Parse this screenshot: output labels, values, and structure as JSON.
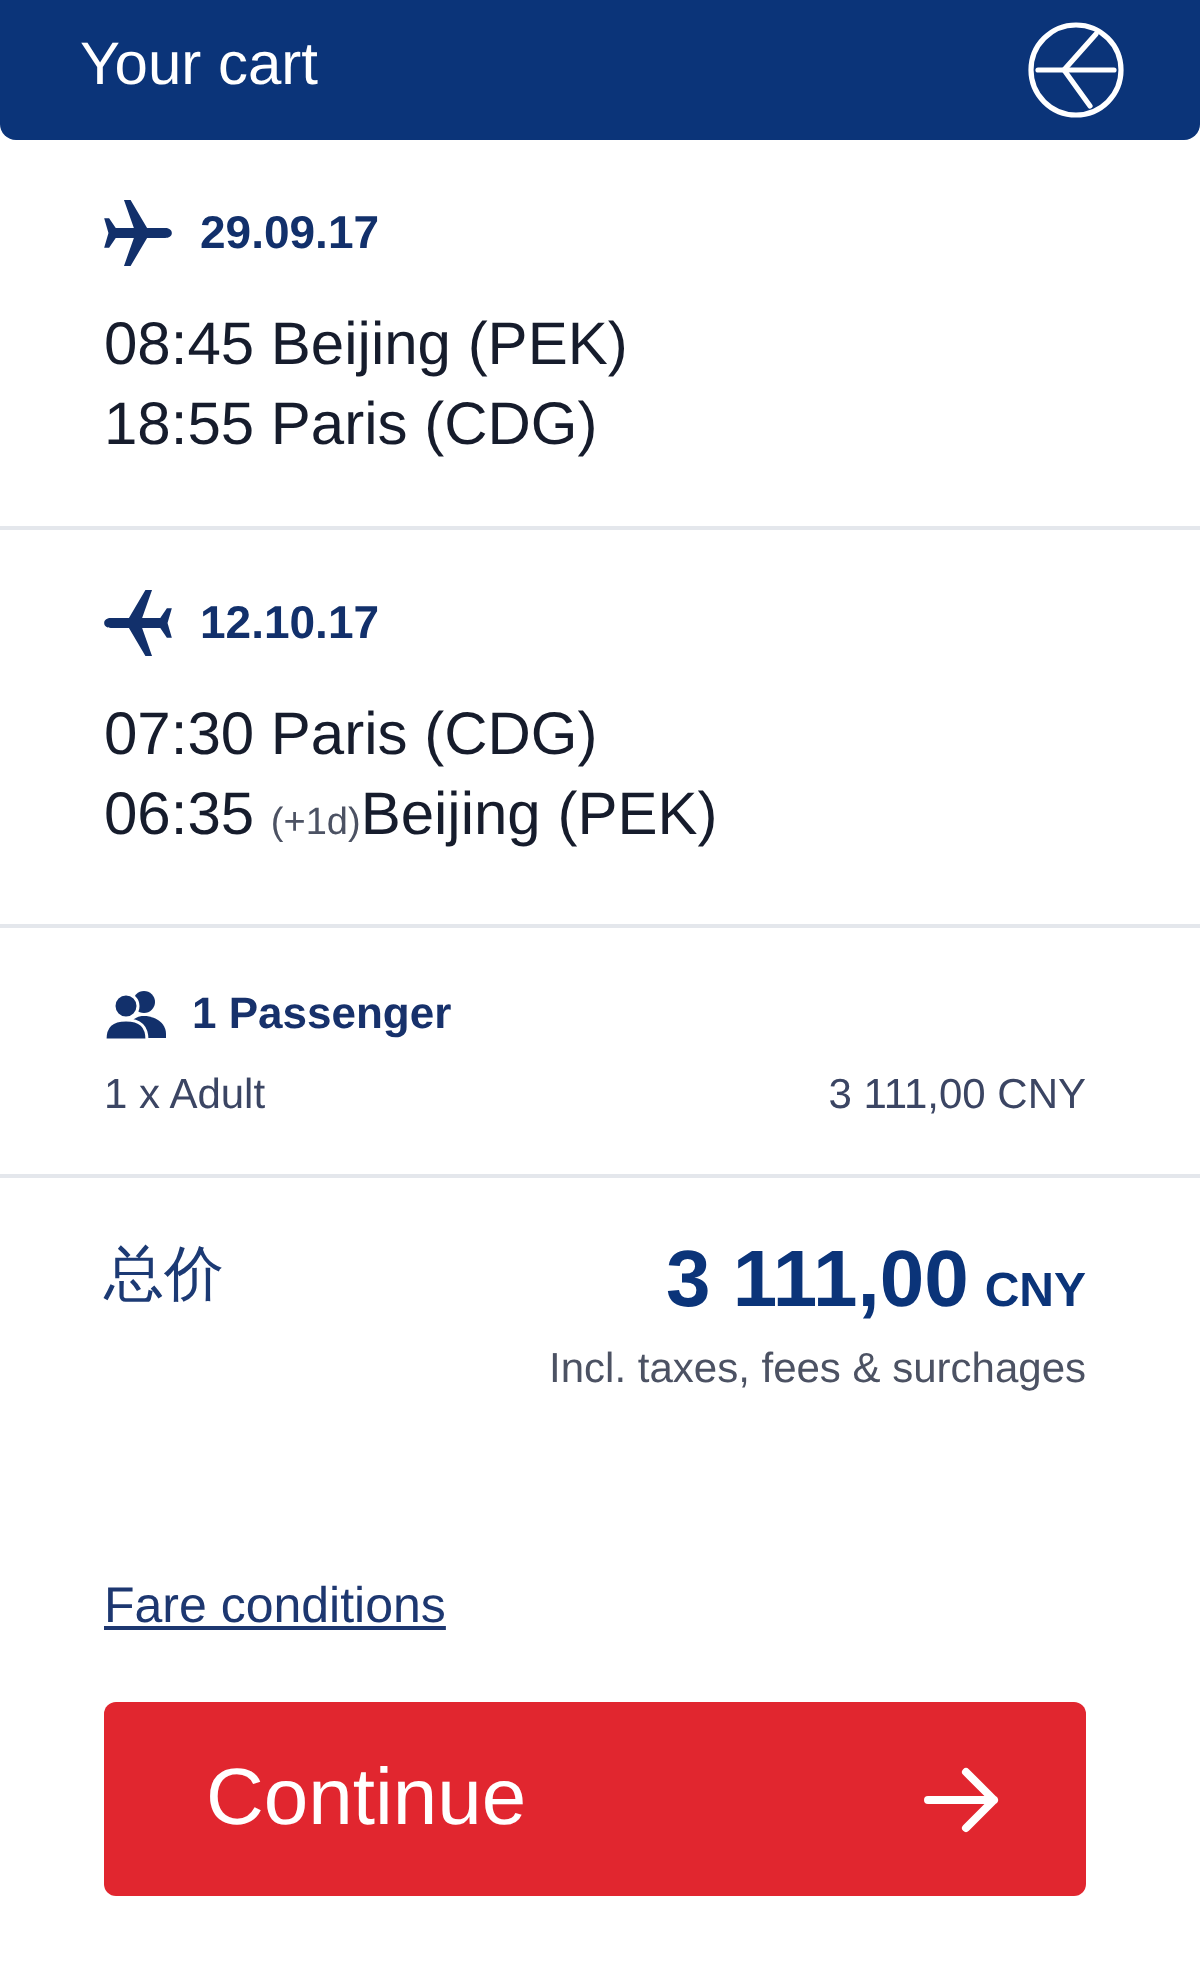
{
  "header": {
    "title": "Your cart"
  },
  "flights": [
    {
      "kind": "outbound",
      "date": "29.09.17",
      "departure": {
        "time": "08:45",
        "place": "Beijing (PEK)"
      },
      "arrival": {
        "time": "18:55",
        "place": "Paris (CDG)"
      }
    },
    {
      "kind": "return",
      "date": "12.10.17",
      "departure": {
        "time": "07:30",
        "place": "Paris (CDG)"
      },
      "arrival": {
        "time": "06:35",
        "day_offset": "(+1d)",
        "place": "Beijing (PEK)"
      }
    }
  ],
  "passengers": {
    "title": "1 Passenger",
    "fares": [
      {
        "label": "1 x Adult",
        "price": "3 111,00 CNY"
      }
    ]
  },
  "total": {
    "label": "总价",
    "amount": "3 111,00",
    "currency": "CNY",
    "note": "Incl. taxes, fees & surchages"
  },
  "fare_conditions_link": "Fare conditions",
  "continue_button": {
    "label": "Continue"
  }
}
